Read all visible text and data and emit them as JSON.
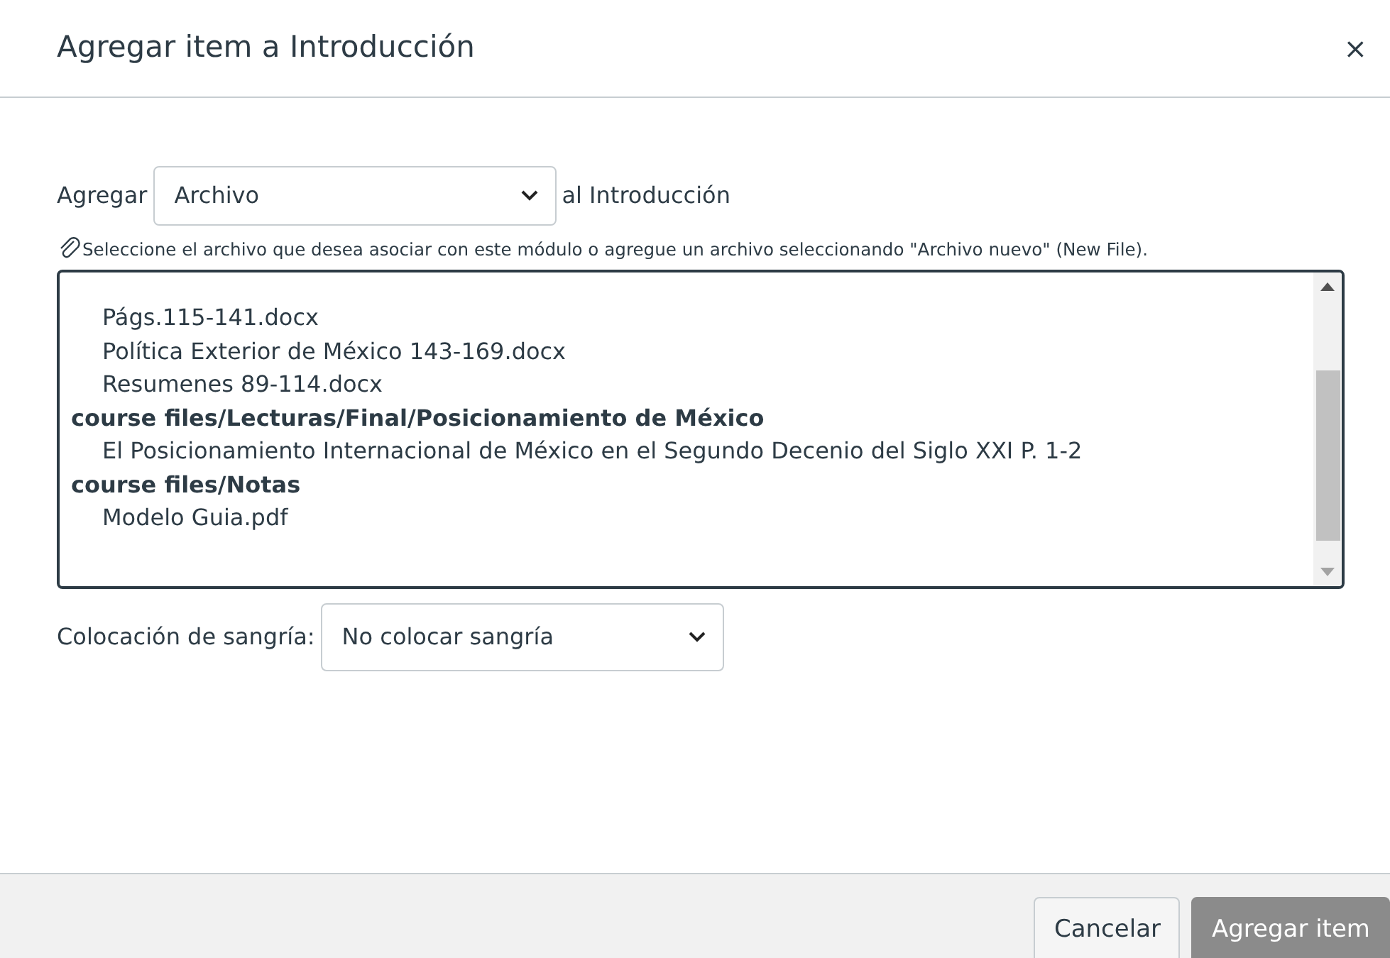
{
  "dialog": {
    "title": "Agregar item a Introducción",
    "close": "×"
  },
  "add_row": {
    "label": "Agregar",
    "select_value": "Archivo",
    "suffix": "al Introducción"
  },
  "hint": "Seleccione el archivo que desea asociar con este módulo o agregue un archivo seleccionando \"Archivo nuevo\" (New File).",
  "file_list": [
    {
      "kind": "file",
      "text": "Págs.115-141.docx"
    },
    {
      "kind": "file",
      "text": "Política Exterior de México 143-169.docx"
    },
    {
      "kind": "file",
      "text": "Resumenes 89-114.docx"
    },
    {
      "kind": "folder",
      "text": "course files/Lecturas/Final/Posicionamiento de México"
    },
    {
      "kind": "file",
      "text": "El Posicionamiento Internacional de México en el Segundo Decenio del Siglo XXI P. 1-2"
    },
    {
      "kind": "folder",
      "text": "course files/Notas"
    },
    {
      "kind": "file",
      "text": "Modelo Guia.pdf"
    }
  ],
  "indent": {
    "label": "Colocación de sangría:",
    "select_value": "No colocar sangría"
  },
  "buttons": [
    {
      "label": "Cancelar",
      "kind": "secondary",
      "disabled": false
    },
    {
      "label": "Agregar item",
      "kind": "primary",
      "disabled": true
    }
  ]
}
